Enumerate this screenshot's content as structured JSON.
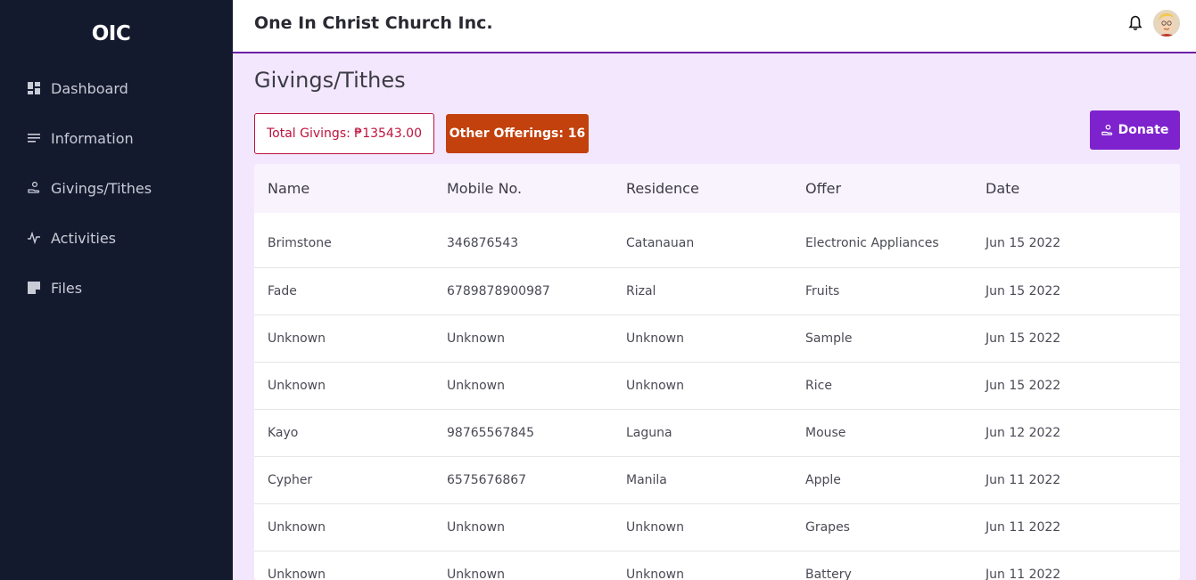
{
  "sidebar": {
    "brand": "OIC",
    "items": [
      {
        "label": "Dashboard",
        "icon": "dashboard-icon"
      },
      {
        "label": "Information",
        "icon": "notes-icon"
      },
      {
        "label": "Givings/Tithes",
        "icon": "hand-giving-icon"
      },
      {
        "label": "Activities",
        "icon": "pulse-icon"
      },
      {
        "label": "Files",
        "icon": "file-icon"
      }
    ]
  },
  "header": {
    "title": "One In Christ Church Inc.",
    "icons": [
      "bell-icon",
      "avatar"
    ]
  },
  "main": {
    "title": "Givings/Tithes",
    "total_givings": "Total Givings: ₱13543.00",
    "other_offerings": "Other Offerings: 16",
    "donate_label": "Donate"
  },
  "table": {
    "columns": [
      "Name",
      "Mobile No.",
      "Residence",
      "Offer",
      "Date"
    ],
    "rows": [
      [
        "Brimstone",
        "346876543",
        "Catanauan",
        "Electronic Appliances",
        "Jun 15 2022"
      ],
      [
        "Fade",
        "6789878900987",
        "Rizal",
        "Fruits",
        "Jun 15 2022"
      ],
      [
        "Unknown",
        "Unknown",
        "Unknown",
        "Sample",
        "Jun 15 2022"
      ],
      [
        "Unknown",
        "Unknown",
        "Unknown",
        "Rice",
        "Jun 15 2022"
      ],
      [
        "Kayo",
        "98765567845",
        "Laguna",
        "Mouse",
        "Jun 12 2022"
      ],
      [
        "Cypher",
        "6575676867",
        "Manila",
        "Apple",
        "Jun 11 2022"
      ],
      [
        "Unknown",
        "Unknown",
        "Unknown",
        "Grapes",
        "Jun 11 2022"
      ],
      [
        "Unknown",
        "Unknown",
        "Unknown",
        "Battery",
        "Jun 11 2022"
      ]
    ]
  },
  "colors": {
    "sidebar_bg": "#141a2e",
    "page_bg": "#f3e7fd",
    "accent_purple": "#7e22ce",
    "total_border": "#be123c",
    "other_bg": "#c2410c"
  }
}
